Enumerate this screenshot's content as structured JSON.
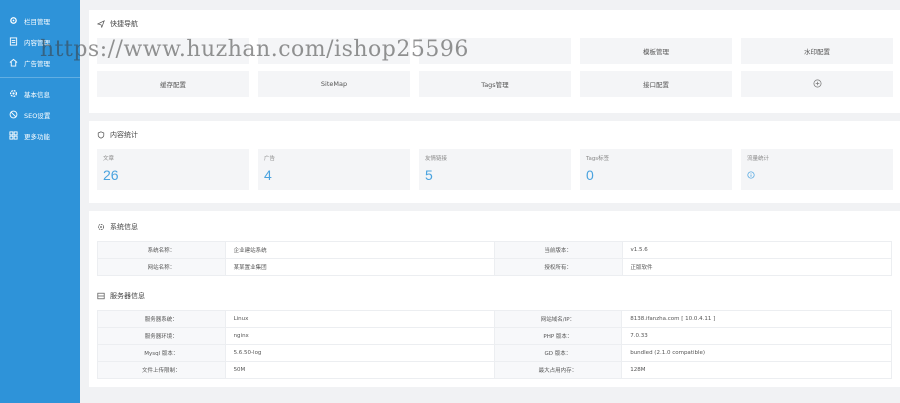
{
  "sidebar": {
    "items": [
      {
        "label": "栏目管理",
        "icon": "gear-icon"
      },
      {
        "label": "内容管理",
        "icon": "document-icon"
      },
      {
        "label": "广告管理",
        "icon": "home-icon"
      }
    ],
    "items2": [
      {
        "label": "基本信息",
        "icon": "settings-icon"
      },
      {
        "label": "SEO设置",
        "icon": "globe-icon"
      },
      {
        "label": "更多功能",
        "icon": "grid-icon"
      }
    ]
  },
  "quicknav": {
    "title": "快捷导航",
    "buttons": [
      "",
      "",
      "",
      "模板管理",
      "水印配置",
      "缓存配置",
      "SiteMap",
      "Tags管理",
      "接口配置",
      ""
    ]
  },
  "stats": {
    "title": "内容统计",
    "items": [
      {
        "label": "文章",
        "value": "26"
      },
      {
        "label": "广告",
        "value": "4"
      },
      {
        "label": "友情链接",
        "value": "5"
      },
      {
        "label": "Tags标签",
        "value": "0"
      },
      {
        "label": "流量统计",
        "value": ""
      }
    ]
  },
  "sysinfo": {
    "title": "系统信息",
    "rows": [
      [
        "系统名称：",
        "企业建站系统",
        "当前版本：",
        "v1.5.6"
      ],
      [
        "网站名称：",
        "某某置业集团",
        "授权所有：",
        "正版软件"
      ]
    ]
  },
  "server": {
    "title": "服务器信息",
    "rows": [
      [
        "服务器系统：",
        "Linux",
        "网站域名/IP：",
        "8138.ifanzha.com [ 10.0.4.11 ]"
      ],
      [
        "服务器环境：",
        "nginx",
        "PHP 版本：",
        "7.0.33"
      ],
      [
        "Mysql 版本：",
        "5.6.50-log",
        "GD 版本：",
        "bundled (2.1.0 compatible)"
      ],
      [
        "文件上传限制：",
        "50M",
        "最大占用内存：",
        "128M"
      ]
    ]
  },
  "watermark": "https://www.huzhan.com/ishop25596",
  "colors": {
    "sidebar": "#2e93d9",
    "accent": "#4aa3df",
    "background": "#f1f2f4"
  }
}
